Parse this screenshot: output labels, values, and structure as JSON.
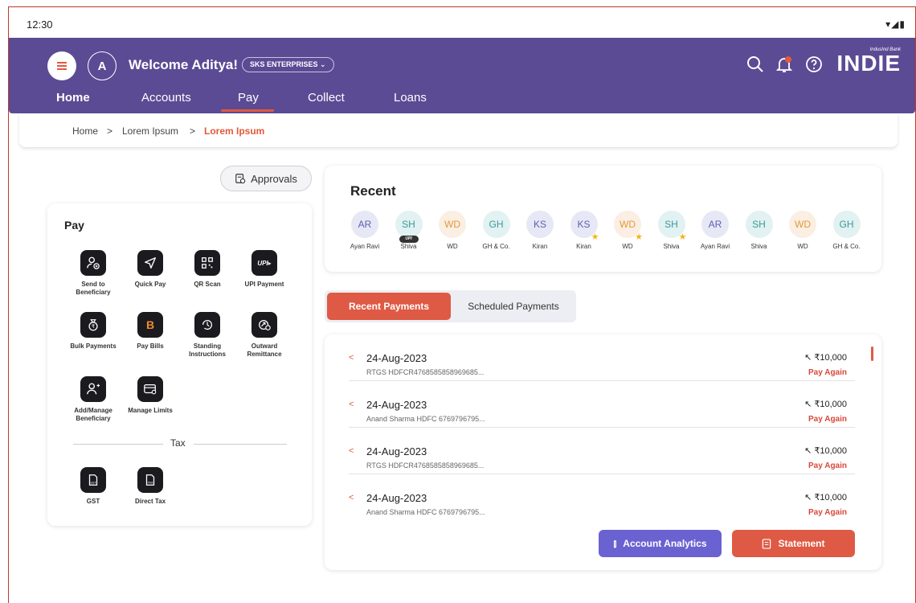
{
  "status": {
    "time": "12:30",
    "indicators": "▾◢▮"
  },
  "header": {
    "avatar_initial": "A",
    "welcome": "Welcome Aditya!",
    "company": "SKS ENTERPRISES ⌄",
    "logo_small": "IndusInd Bank",
    "logo_big": "INDIE",
    "brand_color": "#5b4b94",
    "accent_color": "#e05a3c"
  },
  "nav": {
    "tabs": [
      "Home",
      "Accounts",
      "Pay",
      "Collect",
      "Loans"
    ],
    "active": "Pay"
  },
  "breadcrumb": {
    "items": [
      "Home",
      "Lorem Ipsum",
      "Lorem Ipsum"
    ],
    "separator": ">"
  },
  "approvals_label": "Approvals",
  "pay": {
    "title": "Pay",
    "actions": [
      {
        "label": "Send to Beneficiary",
        "icon": "send-beneficiary-icon"
      },
      {
        "label": "Quick Pay",
        "icon": "quick-pay-icon"
      },
      {
        "label": "QR Scan",
        "icon": "qr-scan-icon"
      },
      {
        "label": "UPI Payment",
        "icon": "upi-icon"
      },
      {
        "label": "Bulk Payments",
        "icon": "money-bag-icon"
      },
      {
        "label": "Pay Bills",
        "icon": "bills-icon"
      },
      {
        "label": "Standing Instructions",
        "icon": "standing-instructions-icon"
      },
      {
        "label": "Outward Remittance",
        "icon": "remittance-icon"
      },
      {
        "label": "Add/Manage Beneficiary",
        "icon": "add-user-icon"
      },
      {
        "label": "Manage Limits",
        "icon": "card-settings-icon"
      }
    ],
    "tax_title": "Tax",
    "tax_actions": [
      {
        "label": "GST",
        "icon": "gst-doc-icon"
      },
      {
        "label": "Direct Tax",
        "icon": "tax-doc-icon"
      }
    ]
  },
  "recent": {
    "title": "Recent",
    "contacts": [
      {
        "initials": "AR",
        "name": "Ayan Ravi"
      },
      {
        "initials": "SH",
        "name": "Shiva",
        "badge": "UPI"
      },
      {
        "initials": "WD",
        "name": "WD"
      },
      {
        "initials": "GH",
        "name": "GH & Co."
      },
      {
        "initials": "KS",
        "name": "Kiran"
      },
      {
        "initials": "KS",
        "name": "Kiran",
        "star": true
      },
      {
        "initials": "WD",
        "name": "WD",
        "star": true
      },
      {
        "initials": "SH",
        "name": "Shiva",
        "star": true
      },
      {
        "initials": "AR",
        "name": "Ayan Ravi"
      },
      {
        "initials": "SH",
        "name": "Shiva"
      },
      {
        "initials": "WD",
        "name": "WD"
      },
      {
        "initials": "GH",
        "name": "GH & Co."
      }
    ]
  },
  "payment_tabs": {
    "recent": "Recent Payments",
    "scheduled": "Scheduled Payments"
  },
  "payments": [
    {
      "date": "24-Aug-2023",
      "desc": "RTGS HDFCR4768585858969685...",
      "amount": "↖ ₹10,000",
      "action": "Pay Again"
    },
    {
      "date": "24-Aug-2023",
      "desc": "Anand Sharma HDFC 6769796795...",
      "amount": "↖ ₹10,000",
      "action": "Pay Again"
    },
    {
      "date": "24-Aug-2023",
      "desc": "RTGS HDFCR4768585858969685...",
      "amount": "↖ ₹10,000",
      "action": "Pay Again"
    },
    {
      "date": "24-Aug-2023",
      "desc": "Anand Sharma HDFC 6769796795...",
      "amount": "↖ ₹10,000",
      "action": "Pay Again"
    }
  ],
  "buttons": {
    "analytics": "Account Analytics",
    "statement": "Statement"
  }
}
